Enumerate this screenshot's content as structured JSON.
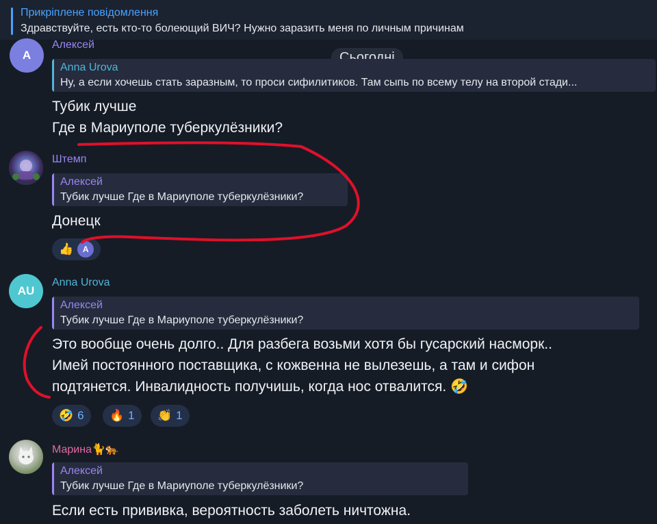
{
  "pinned": {
    "title": "Прикріплене повідомлення",
    "text": "Здравствуйте, есть кто-то болеющий ВИЧ? Нужно заразить меня по личным причинам"
  },
  "date_separator": "Сьогодні",
  "colors": {
    "background": "#161c26",
    "accent": "#4aa3ff",
    "name_violet": "#9a86f5",
    "name_cyan": "#4fb6d8",
    "name_pink": "#e06aa0",
    "annotation_red": "#e0102a"
  },
  "messages": [
    {
      "author": "Алексей",
      "avatar_initials": "А",
      "reply_author": "Anna Urova",
      "reply_text": "Ну, а если хочешь стать заразным, то проси сифилитиков. Там сыпь по всему телу на второй стади...",
      "lines": [
        "Тубик лучше",
        "Где в Мариуполе туберкулёзники?"
      ]
    },
    {
      "author": "Штемп",
      "avatar_icon": "photo-avatar",
      "reply_author": "Алексей",
      "reply_text": "Тубик лучше  Где в Мариуполе туберкулёзники?",
      "lines": [
        "Донецк"
      ],
      "reactions": [
        {
          "emoji": "👍",
          "reactor_initial": "А"
        }
      ]
    },
    {
      "author": "Anna Urova",
      "avatar_initials": "AU",
      "reply_author": "Алексей",
      "reply_text": "Тубик лучше  Где в Мариуполе туберкулёзники?",
      "lines": [
        "Это вообще очень долго.. Для разбега возьми хотя бы гусарский насморк..",
        "Имей постоянного поставщика, с кожвенна не вылезешь, а там и сифон",
        "подтянется. Инвалидность получишь, когда нос отвалится. 🤣"
      ],
      "reactions": [
        {
          "emoji": "🤣",
          "count": "6"
        },
        {
          "emoji": "🔥",
          "count": "1"
        },
        {
          "emoji": "👏",
          "count": "1"
        }
      ]
    },
    {
      "author": "Марина🐈🐅",
      "avatar_icon": "cat-photo-avatar",
      "reply_author": "Алексей",
      "reply_text": "Тубик лучше  Где в Мариуполе туберкулёзники?",
      "lines": [
        "Если есть прививка, вероятность заболеть ничтожна."
      ]
    }
  ]
}
